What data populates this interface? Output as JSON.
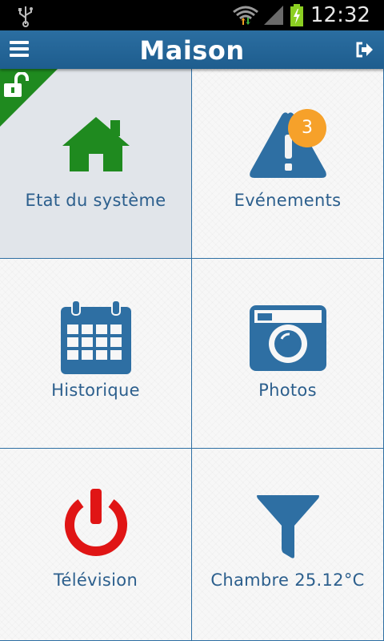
{
  "status_bar": {
    "time": "12:32"
  },
  "header": {
    "title": "Maison"
  },
  "tiles": [
    {
      "label": "Etat du système"
    },
    {
      "label": "Evénements",
      "badge": "3"
    },
    {
      "label": "Historique"
    },
    {
      "label": "Photos"
    },
    {
      "label": "Télévision"
    },
    {
      "label": "Chambre 25.12°C"
    }
  ],
  "colors": {
    "app_bar": "#1e5d8e",
    "tile_border": "#2e6fa3",
    "label_text": "#2c5f8d",
    "icon_blue": "#2e6fa3",
    "home_green": "#1f8a1f",
    "power_red": "#e01515",
    "badge_orange": "#f6a12a"
  },
  "icons": {
    "menu": "menu-icon",
    "logout": "logout-icon",
    "lock": "unlocked-padlock-icon",
    "tiles": [
      "home-icon",
      "warning-triangle-icon",
      "calendar-icon",
      "camera-icon",
      "power-icon",
      "filter-icon"
    ]
  }
}
